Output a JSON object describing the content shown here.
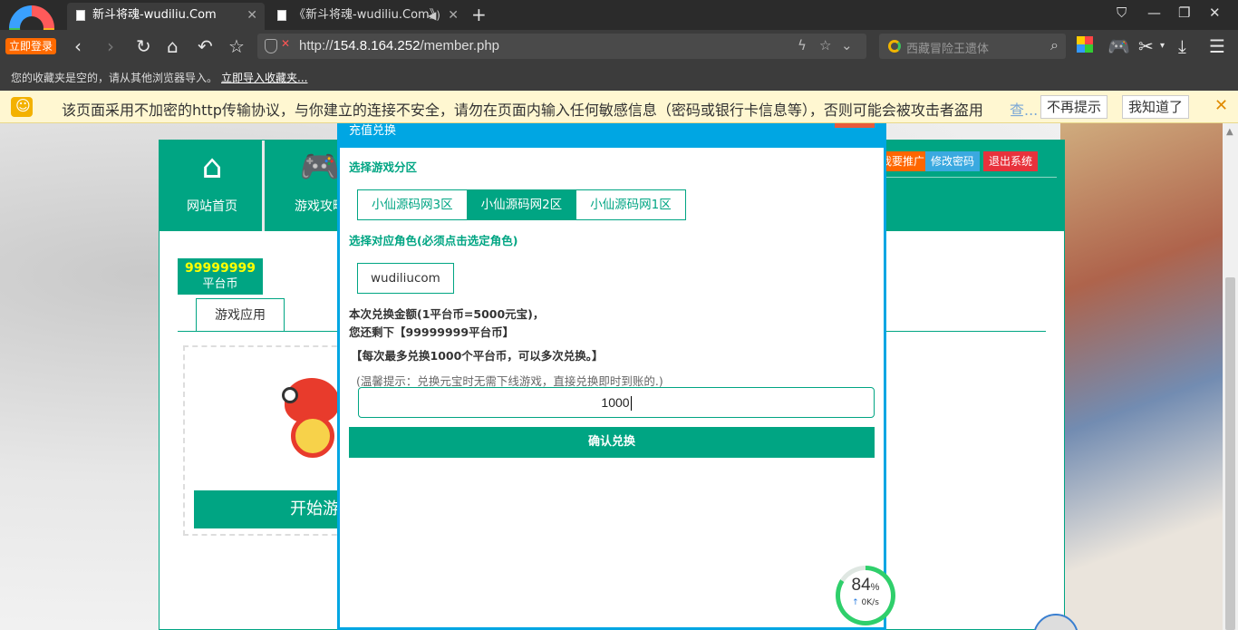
{
  "browser": {
    "login_badge": "立即登录",
    "tabs": [
      {
        "title": "新斗将魂-wudiliu.Com",
        "active": true
      },
      {
        "title": "《新斗将魂-wudiliu.Com》",
        "active": false
      }
    ],
    "url_prefix": "http://",
    "url_host": "154.8.164.252",
    "url_path": "/member.php",
    "search_placeholder": "西藏冒险王遗体",
    "favorites_msg": "您的收藏夹是空的，请从其他浏览器导入。",
    "favorites_link": "立即导入收藏夹..."
  },
  "warning": {
    "text": "该页面采用不加密的http传输协议，与你建立的连接不安全，请勿在页面内输入任何敏感信息（密码或银行卡信息等），否则可能会被攻击者盗用",
    "more": "查...",
    "btn_dismiss": "不再提示",
    "btn_ok": "我知道了"
  },
  "site": {
    "nav": [
      {
        "label": "网站首页",
        "icon": "home-icon"
      },
      {
        "label": "游戏攻略",
        "icon": "gamepad-icon"
      }
    ],
    "top_buttons": [
      {
        "label": "我要推广",
        "color": "#ff6600"
      },
      {
        "label": "修改密码",
        "color": "#3aa9e0"
      },
      {
        "label": "退出系统",
        "color": "#e8323c"
      }
    ],
    "coin_value": "99999999",
    "coin_label": "平台币",
    "tab_label": "游戏应用",
    "play_label": "开始游戏"
  },
  "modal": {
    "title": "充值兑换",
    "zone_label": "选择游戏分区",
    "zones": [
      {
        "label": "小仙源码网3区",
        "selected": false
      },
      {
        "label": "小仙源码网2区",
        "selected": true
      },
      {
        "label": "小仙源码网1区",
        "selected": false
      }
    ],
    "role_label": "选择对应角色(必须点击选定角色)",
    "role": "wudiliucom",
    "rate_line": "本次兑换金额(1平台币=5000元宝)，",
    "remain_line": "您还剩下【99999999平台币】",
    "limit_line": "【每次最多兑换1000个平台币，可以多次兑换。】",
    "tip": "(温馨提示：兑换元宝时无需下线游戏，直接兑换即时到账的.)",
    "amount": "1000",
    "confirm": "确认兑换"
  },
  "speed_widget": {
    "percent": "84",
    "unit": "%",
    "rate": "0K/s",
    "fraction": 0.84
  }
}
